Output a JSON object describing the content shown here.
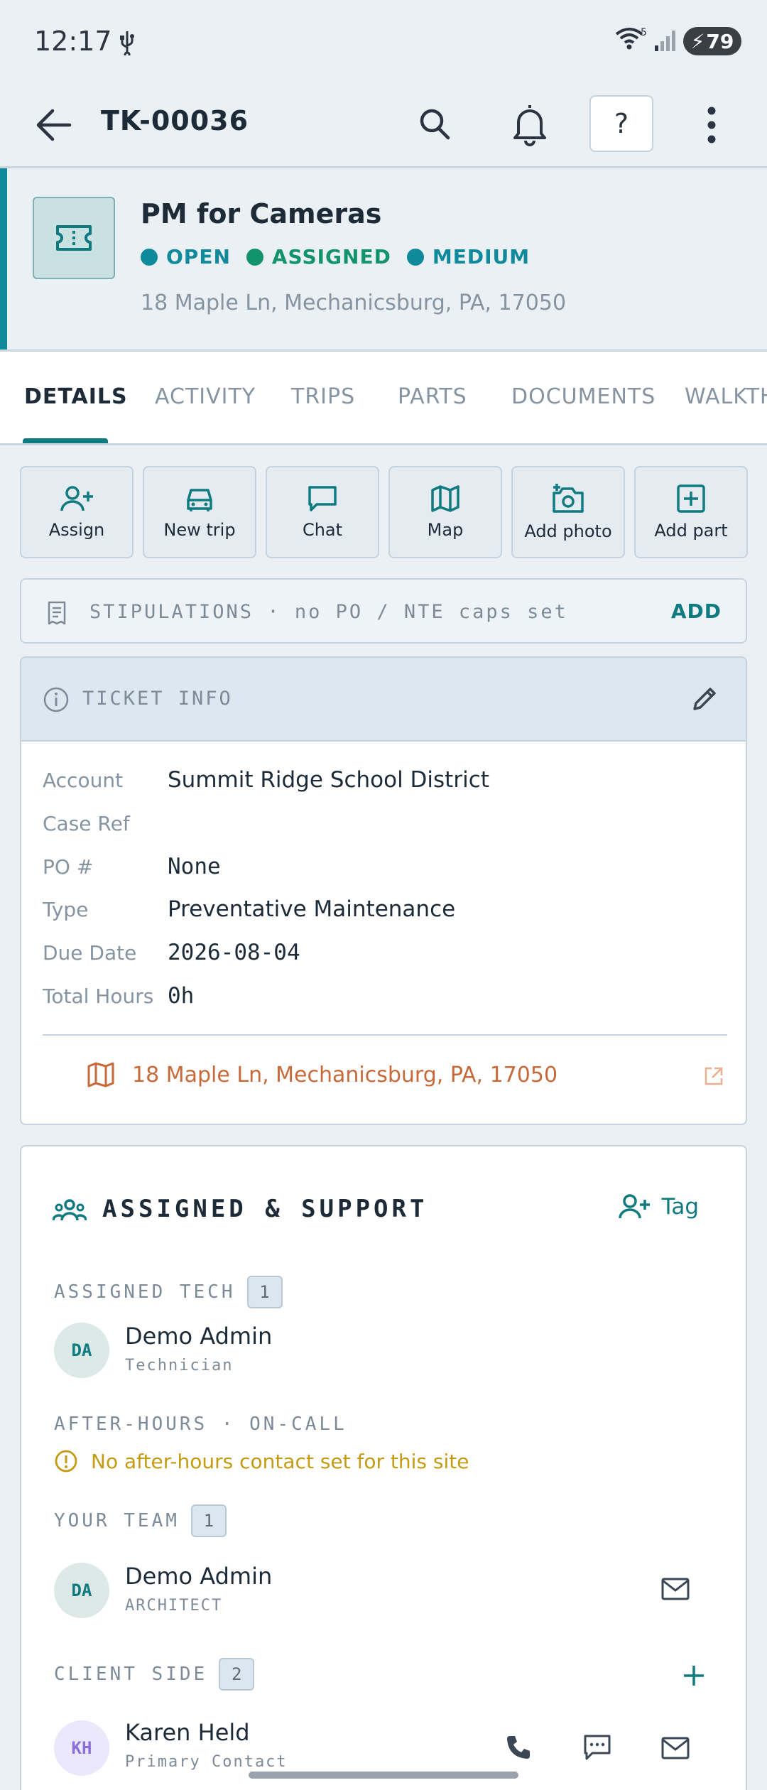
{
  "status_bar": {
    "time": "12:17",
    "battery": "79"
  },
  "app_bar": {
    "title": "TK-00036",
    "help_label": "?"
  },
  "ticket": {
    "title": "PM for Cameras",
    "badges": [
      {
        "label": "OPEN",
        "color": "#0f8a9c"
      },
      {
        "label": "ASSIGNED",
        "color": "#12936b"
      },
      {
        "label": "MEDIUM",
        "color": "#0f8a9c"
      }
    ],
    "address": "18 Maple Ln, Mechanicsburg, PA, 17050"
  },
  "tabs": [
    "DETAILS",
    "ACTIVITY",
    "TRIPS",
    "PARTS",
    "DOCUMENTS",
    "WALKTH"
  ],
  "actions": [
    {
      "label": "Assign",
      "icon": "user-plus-icon"
    },
    {
      "label": "New trip",
      "icon": "car-icon"
    },
    {
      "label": "Chat",
      "icon": "chat-icon"
    },
    {
      "label": "Map",
      "icon": "map-icon"
    },
    {
      "label": "Add photo",
      "icon": "camera-plus-icon"
    },
    {
      "label": "Add part",
      "icon": "plus-square-icon"
    }
  ],
  "stipulations": {
    "text": "STIPULATIONS · no PO / NTE caps set",
    "action": "ADD"
  },
  "ticket_info": {
    "title": "TICKET INFO",
    "rows": [
      {
        "label": "Account",
        "value": "Summit Ridge School District"
      },
      {
        "label": "Case Ref",
        "value": ""
      },
      {
        "label": "PO #",
        "value": "None"
      },
      {
        "label": "Type",
        "value": "Preventative Maintenance"
      },
      {
        "label": "Due Date",
        "value": "2026-08-04"
      },
      {
        "label": "Total Hours",
        "value": "0h"
      }
    ],
    "map_link": "18 Maple Ln, Mechanicsburg, PA, 17050"
  },
  "assigned": {
    "title": "ASSIGNED & SUPPORT",
    "tag_label": "Tag",
    "tech": {
      "label": "ASSIGNED TECH",
      "count": "1",
      "initials": "DA",
      "name": "Demo Admin",
      "role": "Technician"
    },
    "after_hours": {
      "label": "AFTER-HOURS · ON-CALL",
      "warning": "No after-hours contact set for this site"
    },
    "team": {
      "label": "YOUR TEAM",
      "count": "1",
      "initials": "DA",
      "name": "Demo Admin",
      "role": "ARCHITECT"
    },
    "client": {
      "label": "CLIENT SIDE",
      "count": "2",
      "initials": "KH",
      "name": "Karen Held",
      "role": "Primary Contact"
    }
  }
}
